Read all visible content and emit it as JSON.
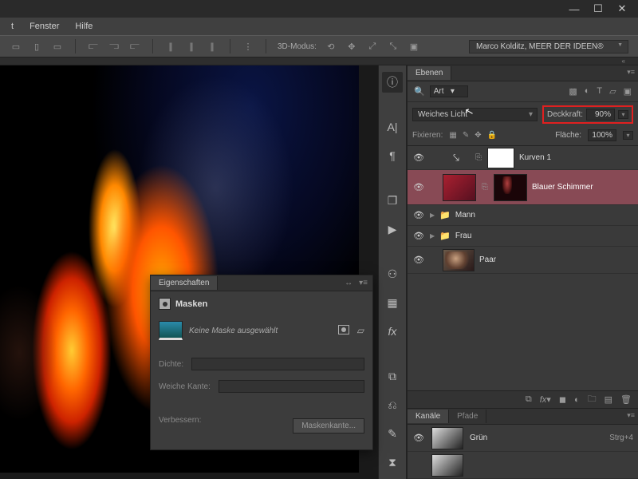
{
  "window": {
    "min": "—",
    "max": "☐",
    "close": "✕"
  },
  "menubar": {
    "items": [
      "t",
      "Fenster",
      "Hilfe"
    ]
  },
  "optionsbar": {
    "mode_label": "3D-Modus:",
    "author": "Marco Kolditz, MEER DER IDEEN®"
  },
  "layers_panel": {
    "tab": "Ebenen",
    "filter_label": "Art",
    "blend_mode": "Weiches Licht",
    "opacity_label": "Deckkraft:",
    "opacity_value": "90%",
    "fill_label": "Fläche:",
    "fill_value": "100%",
    "lock_label": "Fixieren:",
    "layers": [
      {
        "name": "Kurven 1"
      },
      {
        "name": "Blauer Schimmer"
      },
      {
        "name": "Mann"
      },
      {
        "name": "Frau"
      },
      {
        "name": "Paar"
      }
    ]
  },
  "channels_panel": {
    "tabs": [
      "Kanäle",
      "Pfade"
    ],
    "rows": [
      {
        "name": "Grün",
        "shortcut": "Strg+4"
      }
    ]
  },
  "properties_panel": {
    "tab": "Eigenschaften",
    "subtitle": "Masken",
    "no_mask": "Keine Maske ausgewählt",
    "density": "Dichte:",
    "feather": "Weiche Kante:",
    "refine": "Verbessern:",
    "edge_btn": "Maskenkante..."
  }
}
